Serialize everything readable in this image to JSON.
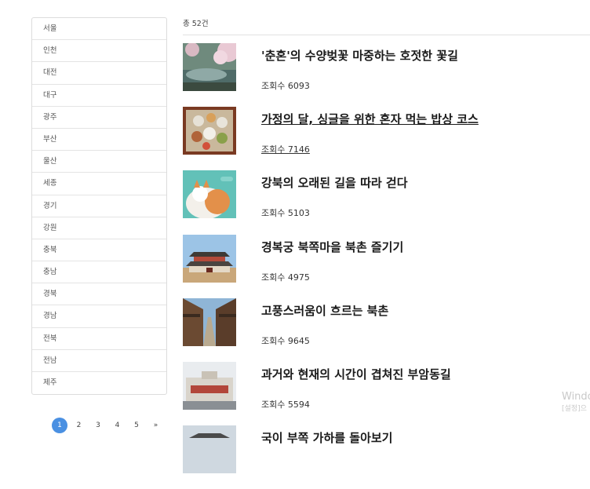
{
  "sidebar": {
    "items": [
      "서울",
      "인천",
      "대전",
      "대구",
      "광주",
      "부산",
      "울산",
      "세종",
      "경기",
      "강원",
      "충북",
      "충남",
      "경북",
      "경남",
      "전북",
      "전남",
      "제주"
    ]
  },
  "pagination": {
    "pages": [
      "1",
      "2",
      "3",
      "4",
      "5"
    ],
    "next_label": "»",
    "active": "1"
  },
  "main": {
    "count_label": "총 52건",
    "items": [
      {
        "title": "'춘혼'의 수양벚꽃 마중하는 호젓한 꽃길",
        "views": "조회수 6093"
      },
      {
        "title": "가정의 달, 싱글을 위한 혼자 먹는 밥상 코스",
        "views": "조회수 7146"
      },
      {
        "title": "강북의 오래된 길을 따라 걷다",
        "views": "조회수 5103"
      },
      {
        "title": "경복궁 북쪽마을 북촌 즐기기",
        "views": "조회수 4975"
      },
      {
        "title": "고풍스러움이 흐르는 북촌",
        "views": "조회수 9645"
      },
      {
        "title": "과거와 현재의 시간이 겹쳐진 부암동길",
        "views": "조회수 5594"
      },
      {
        "title": "국이 부쪽 가하를 돌아보기",
        "views": ""
      }
    ]
  },
  "watermark": {
    "line1": "Windo",
    "line2": "[설정]으"
  },
  "colors": {
    "accent": "#4a90e2"
  }
}
